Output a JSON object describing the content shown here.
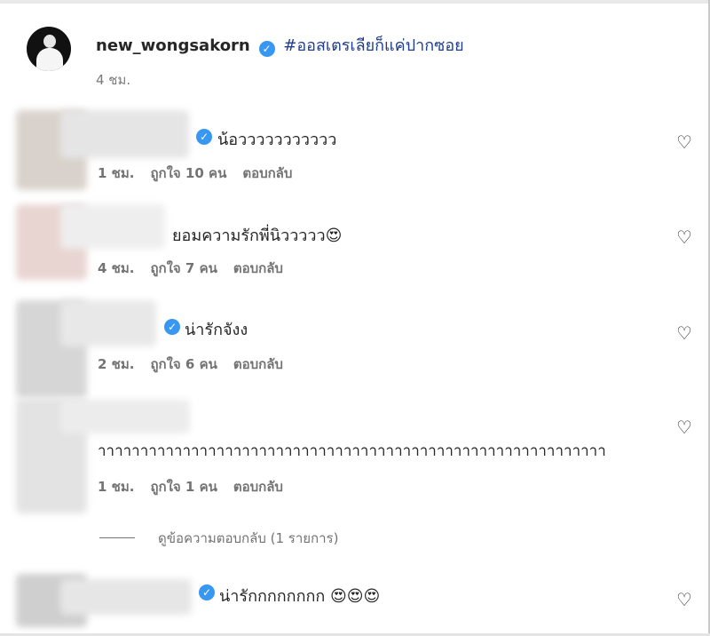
{
  "post": {
    "username": "new_wongsakorn",
    "caption": "#ออสเตรเลียก็แค่ปากซอย",
    "time": "4 ชม."
  },
  "comments": [
    {
      "text": "น้อววววววววววว",
      "time": "1 ชม.",
      "likes": "ถูกใจ 10 คน",
      "reply": "ตอบกลับ",
      "verified": true
    },
    {
      "text": "ยอมความรักพี่นิววววว😍",
      "time": "4 ชม.",
      "likes": "ถูกใจ 7 คน",
      "reply": "ตอบกลับ",
      "verified": false
    },
    {
      "text": "น่ารักจังง",
      "time": "2 ชม.",
      "likes": "ถูกใจ 6 คน",
      "reply": "ตอบกลับ",
      "verified": true
    },
    {
      "text": "าาาาาาาาาาาาาาาาาาาาาาาาาาาาาาาาาาาาาาาาาาาาาาาาาาาาาาาาาาาา",
      "time": "1 ชม.",
      "likes": "ถูกใจ 1 คน",
      "reply": "ตอบกลับ",
      "verified": false
    },
    {
      "text": "น่ารักกกกกกกก 😍😍😍",
      "verified": true
    }
  ],
  "view_replies": "ดูข้อความตอบกลับ (1 รายการ)",
  "icons": {
    "verified": "verified-check-icon",
    "like": "heart-outline-icon"
  },
  "colors": {
    "verified": "#3897f0",
    "hashtag": "#1f3d8f",
    "meta": "#737373"
  }
}
